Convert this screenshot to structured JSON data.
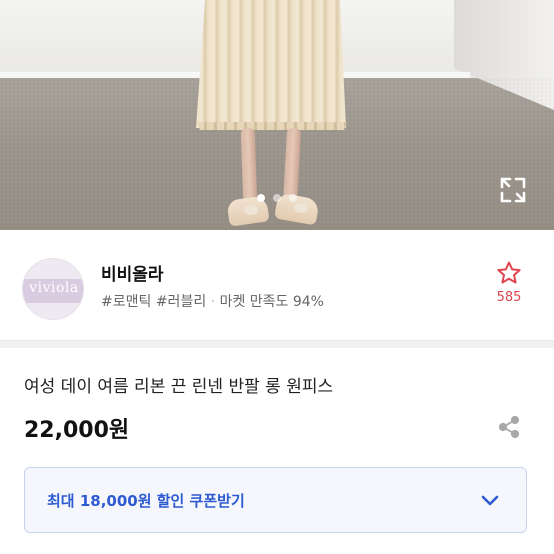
{
  "gallery": {
    "slides": 3,
    "active_index": 0,
    "expand_icon": "expand-icon"
  },
  "seller": {
    "logo_text": "viviola",
    "name": "비비올라",
    "tag1": "#로맨틱",
    "tag2": "#러블리",
    "separator": "·",
    "satisfaction": "마켓 만족도 94%",
    "favorite_icon": "star-outline-icon",
    "favorite_count": "585"
  },
  "product": {
    "title": "여성 데이 여름 리본 끈 린넨 반팔 롱 원피스",
    "price": "22,000원",
    "share_icon": "share-icon"
  },
  "coupon": {
    "label": "최대 18,000원 할인 쿠폰받기",
    "chevron_icon": "chevron-down-icon"
  },
  "colors": {
    "accent_blue": "#2e5bd0",
    "favorite_red": "#e0454f",
    "coupon_bg": "#f5f7fd",
    "coupon_border": "#c8d3ec"
  }
}
